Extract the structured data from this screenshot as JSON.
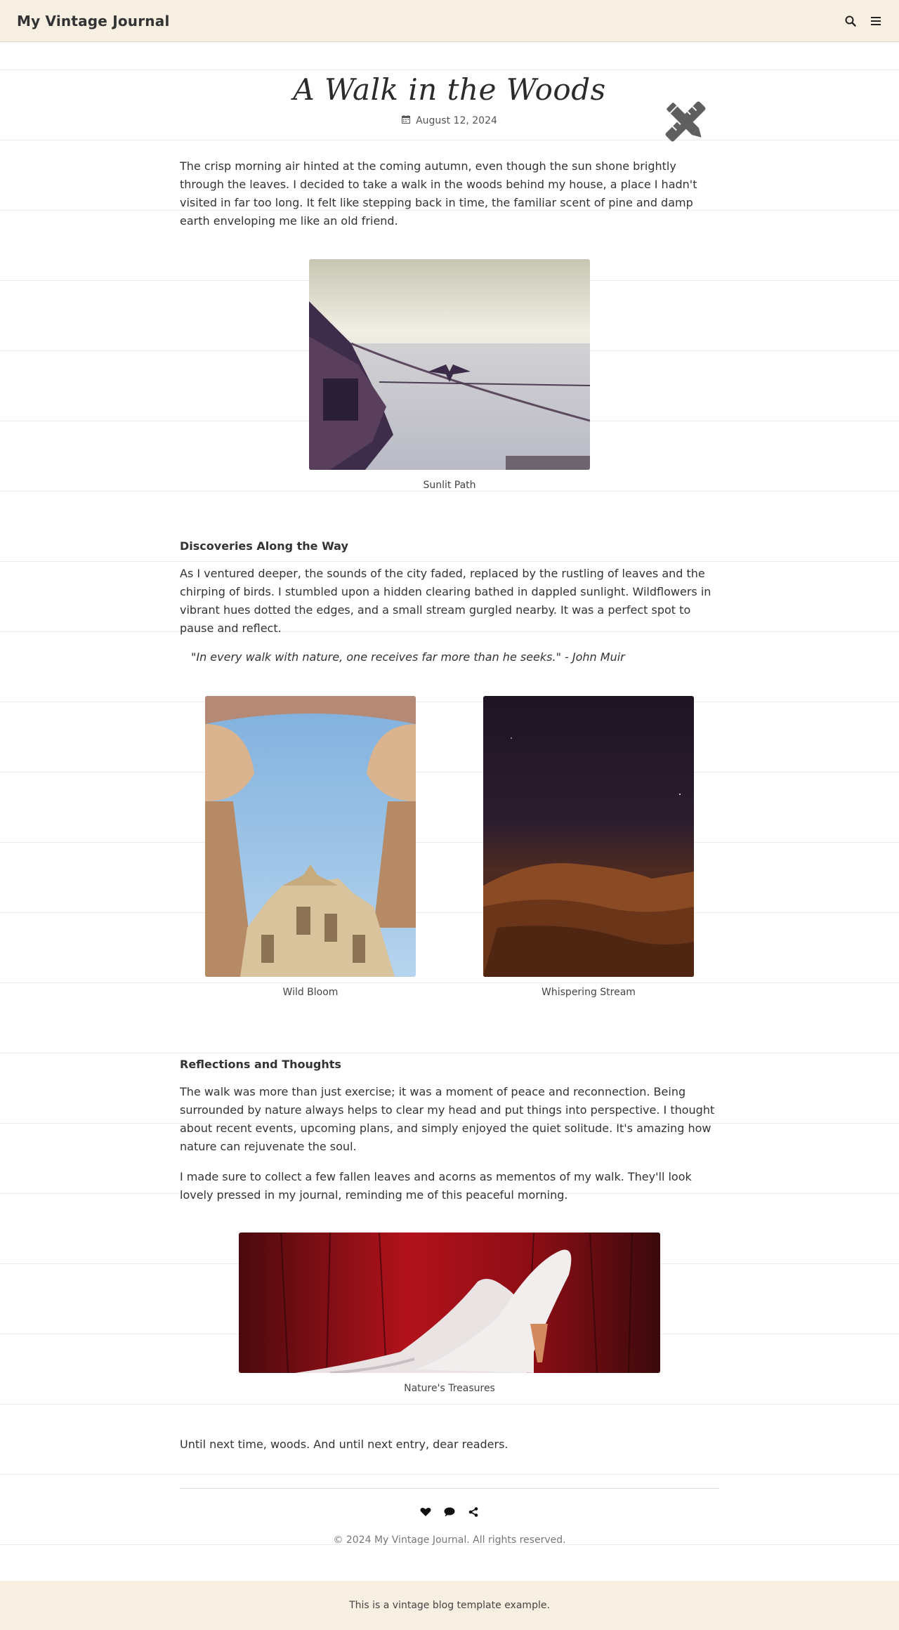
{
  "header": {
    "brand": "My Vintage Journal",
    "icons": [
      "search-icon",
      "menu-icon"
    ]
  },
  "post": {
    "title": "A Walk in the Woods",
    "date": "August 12, 2024",
    "date_icon": "calendar-icon",
    "stamp_icon": "pencil-ruler-icon",
    "intro": "The crisp morning air hinted at the coming autumn, even though the sun shone brightly through the leaves. I decided to take a walk in the woods behind my house, a place I hadn't visited in far too long. It felt like stepping back in time, the familiar scent of pine and damp earth enveloping me like an old friend.",
    "figure1_caption": "Sunlit Path",
    "section1_heading": "Discoveries Along the Way",
    "section1_text": "As I ventured deeper, the sounds of the city faded, replaced by the rustling of leaves and the chirping of birds. I stumbled upon a hidden clearing bathed in dappled sunlight. Wildflowers in vibrant hues dotted the edges, and a small stream gurgled nearby. It was a perfect spot to pause and reflect.",
    "quote": "\"In every walk with nature, one receives far more than he seeks.\" - John Muir",
    "figure2_caption": "Wild Bloom",
    "figure3_caption": "Whispering Stream",
    "section2_heading": "Reflections and Thoughts",
    "section2_text1": "The walk was more than just exercise; it was a moment of peace and reconnection. Being surrounded by nature always helps to clear my head and put things into perspective. I thought about recent events, upcoming plans, and simply enjoyed the quiet solitude. It's amazing how nature can rejuvenate the soul.",
    "section2_text2": "I made sure to collect a few fallen leaves and acorns as mementos of my walk. They'll look lovely pressed in my journal, reminding me of this peaceful morning.",
    "figure4_caption": "Nature's Treasures",
    "closing": "Until next time, woods. And until next entry, dear readers."
  },
  "post_footer": {
    "social_icons": [
      "heart-icon",
      "comment-icon",
      "share-icon"
    ],
    "copyright": "© 2024 My Vintage Journal. All rights reserved."
  },
  "site_footer": {
    "text": "This is a vintage blog template example."
  },
  "colors": {
    "header_bg": "#f6efe2",
    "text": "#333333",
    "muted": "#777777"
  }
}
